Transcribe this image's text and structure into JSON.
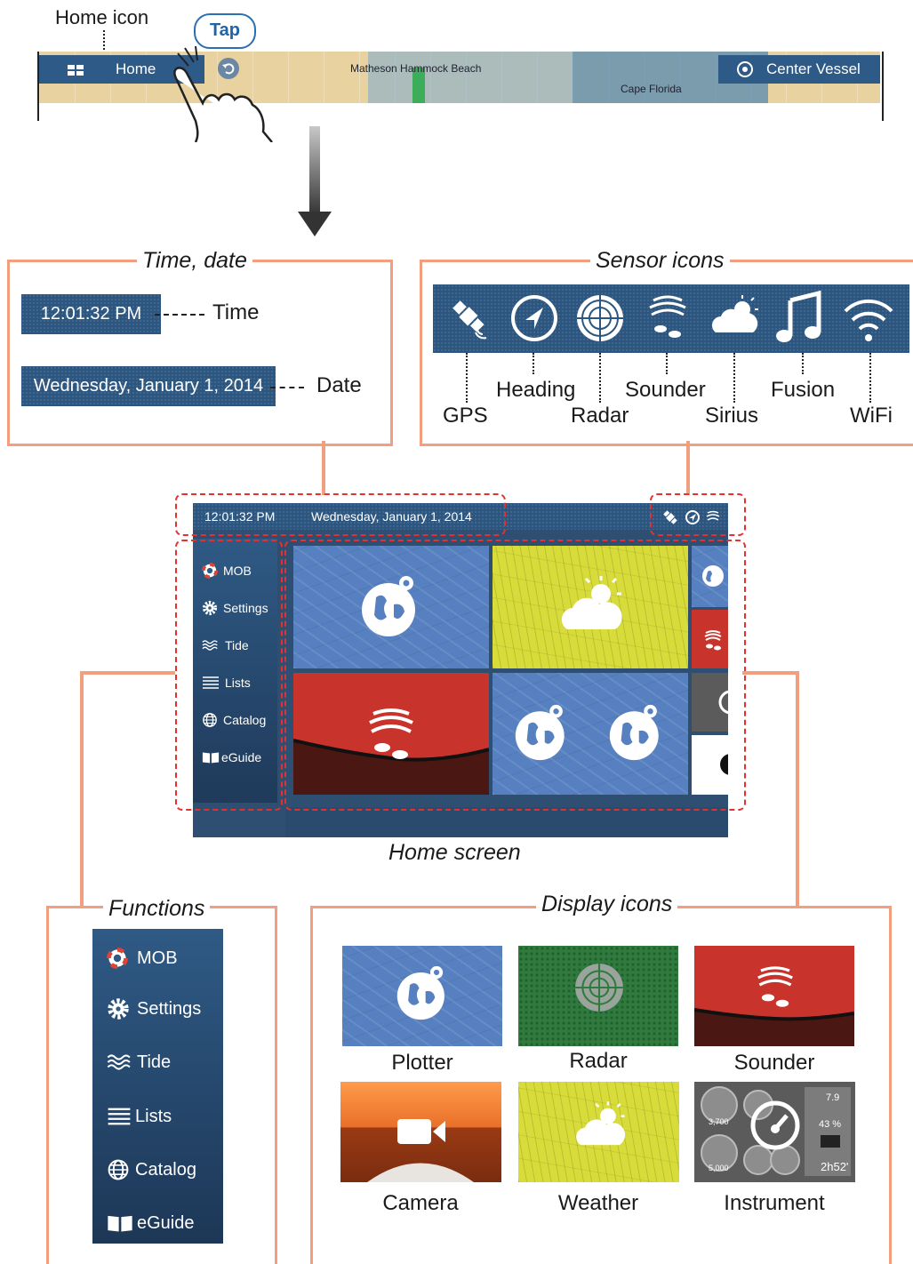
{
  "top_strip": {
    "home_icon_label": "Home icon",
    "tap_label": "Tap",
    "home_button_label": "Home",
    "map_label_1": "Matheson Hammock Beach",
    "map_label_2": "Cape Florida",
    "center_vessel_label": "Center Vessel"
  },
  "time_date": {
    "title": "Time, date",
    "time_value": "12:01:32 PM",
    "time_callout": "Time",
    "date_value": "Wednesday, January 1, 2014",
    "date_callout": "Date"
  },
  "sensor_icons": {
    "title": "Sensor icons",
    "items": [
      {
        "label": "GPS",
        "icon": "gps-satellite-icon"
      },
      {
        "label": "Heading",
        "icon": "heading-arrow-icon"
      },
      {
        "label": "Radar",
        "icon": "radar-icon"
      },
      {
        "label": "Sounder",
        "icon": "sounder-icon"
      },
      {
        "label": "Sirius",
        "icon": "sirius-weather-icon"
      },
      {
        "label": "Fusion",
        "icon": "music-note-icon"
      },
      {
        "label": "WiFi",
        "icon": "wifi-icon"
      }
    ]
  },
  "home_screen": {
    "caption": "Home screen",
    "time": "12:01:32 PM",
    "date": "Wednesday, January 1, 2014",
    "functions": [
      "MOB",
      "Settings",
      "Tide",
      "Lists",
      "Catalog",
      "eGuide"
    ]
  },
  "functions_panel": {
    "title": "Functions",
    "items": [
      "MOB",
      "Settings",
      "Tide",
      "Lists",
      "Catalog",
      "eGuide"
    ]
  },
  "display_icons": {
    "title": "Display icons",
    "items": [
      "Plotter",
      "Radar",
      "Sounder",
      "Camera",
      "Weather",
      "Instrument"
    ],
    "instrument_readouts": [
      "7.9",
      "43 %",
      "2h52'",
      "3,700",
      "5,000"
    ]
  },
  "colors": {
    "callout_salmon": "#f29f80",
    "navy": "#2d5a86",
    "plotter_blue": "#5680c0",
    "weather_yellow": "#d8dc3a",
    "sounder_red": "#c8332b",
    "selection_dash_red": "#e53030"
  }
}
